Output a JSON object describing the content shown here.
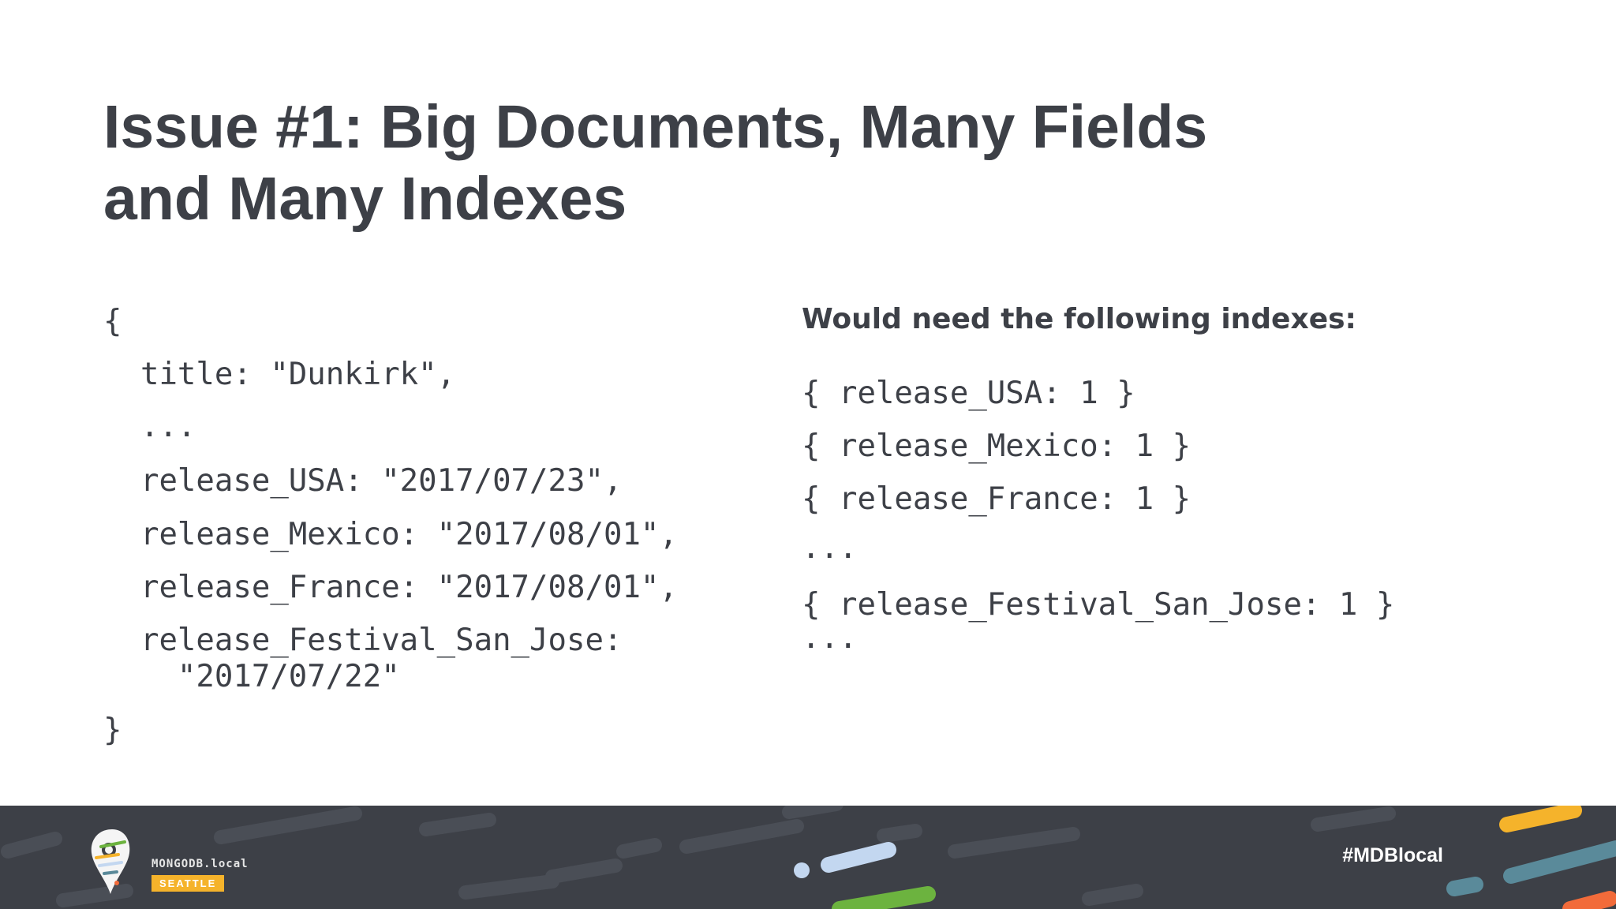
{
  "slide": {
    "title_line1": "Issue #1: Big Documents, Many Fields",
    "title_line2": "and Many Indexes"
  },
  "document_example": {
    "lines": [
      "{",
      "  title: \"Dunkirk\",",
      "  ...",
      "  release_USA: \"2017/07/23\",",
      "  release_Mexico: \"2017/08/01\",",
      "  release_France: \"2017/08/01\",",
      "  release_Festival_San_Jose:",
      "    \"2017/07/22\"",
      "}"
    ]
  },
  "indexes": {
    "heading": "Would need the following indexes:",
    "lines": [
      "{ release_USA: 1 }",
      "{ release_Mexico: 1 }",
      "{ release_France: 1 }",
      "...",
      "{ release_Festival_San_Jose: 1 }",
      "..."
    ]
  },
  "footer": {
    "brand": "MONGODB.local",
    "city": "SEATTLE",
    "hashtag": "#MDBlocal"
  },
  "colors": {
    "text": "#3d4047",
    "footer_bg": "#3d4047",
    "accent_yellow": "#f5b32b",
    "accent_green": "#6cb33f",
    "accent_blue": "#b8d4f0",
    "accent_teal": "#5a8a9a",
    "accent_orange": "#f26b3a"
  }
}
